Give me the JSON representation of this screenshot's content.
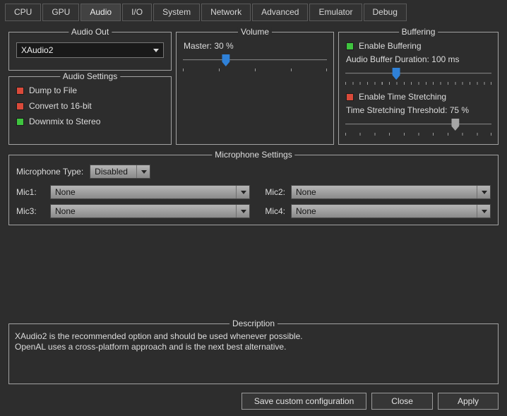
{
  "tabs": {
    "active": "Audio",
    "items": [
      {
        "label": "CPU"
      },
      {
        "label": "GPU"
      },
      {
        "label": "Audio"
      },
      {
        "label": "I/O"
      },
      {
        "label": "System"
      },
      {
        "label": "Network"
      },
      {
        "label": "Advanced"
      },
      {
        "label": "Emulator"
      },
      {
        "label": "Debug"
      }
    ]
  },
  "audio_out": {
    "title": "Audio Out",
    "selected": "XAudio2"
  },
  "audio_settings": {
    "title": "Audio Settings",
    "options": [
      {
        "label": "Dump to File",
        "checked": false
      },
      {
        "label": "Convert to 16-bit",
        "checked": false
      },
      {
        "label": "Downmix to Stereo",
        "checked": true
      }
    ]
  },
  "volume": {
    "title": "Volume",
    "master_label": "Master: 30 %",
    "value": 30
  },
  "buffering": {
    "title": "Buffering",
    "enable_buffering_label": "Enable Buffering",
    "enable_buffering_checked": true,
    "duration_label": "Audio Buffer Duration: 100 ms",
    "duration_value": 100,
    "time_stretching_label": "Enable Time Stretching",
    "time_stretching_checked": false,
    "threshold_label": "Time Stretching Threshold: 75 %",
    "threshold_value": 75
  },
  "microphone": {
    "title": "Microphone Settings",
    "type_label": "Microphone Type:",
    "type_value": "Disabled",
    "mics": [
      {
        "label": "Mic1:",
        "value": "None"
      },
      {
        "label": "Mic2:",
        "value": "None"
      },
      {
        "label": "Mic3:",
        "value": "None"
      },
      {
        "label": "Mic4:",
        "value": "None"
      }
    ]
  },
  "description": {
    "title": "Description",
    "line1": "XAudio2 is the recommended option and should be used whenever possible.",
    "line2": "OpenAL uses a cross-platform approach and is the next best alternative."
  },
  "footer": {
    "save_label": "Save custom configuration",
    "close_label": "Close",
    "apply_label": "Apply"
  },
  "colors": {
    "checkbox_checked": "#3fc43f",
    "checkbox_unchecked": "#da4a3a",
    "slider_handle": "#2f81d8",
    "slider_handle_disabled": "#a5a5a5",
    "background": "#2d2d2d"
  }
}
